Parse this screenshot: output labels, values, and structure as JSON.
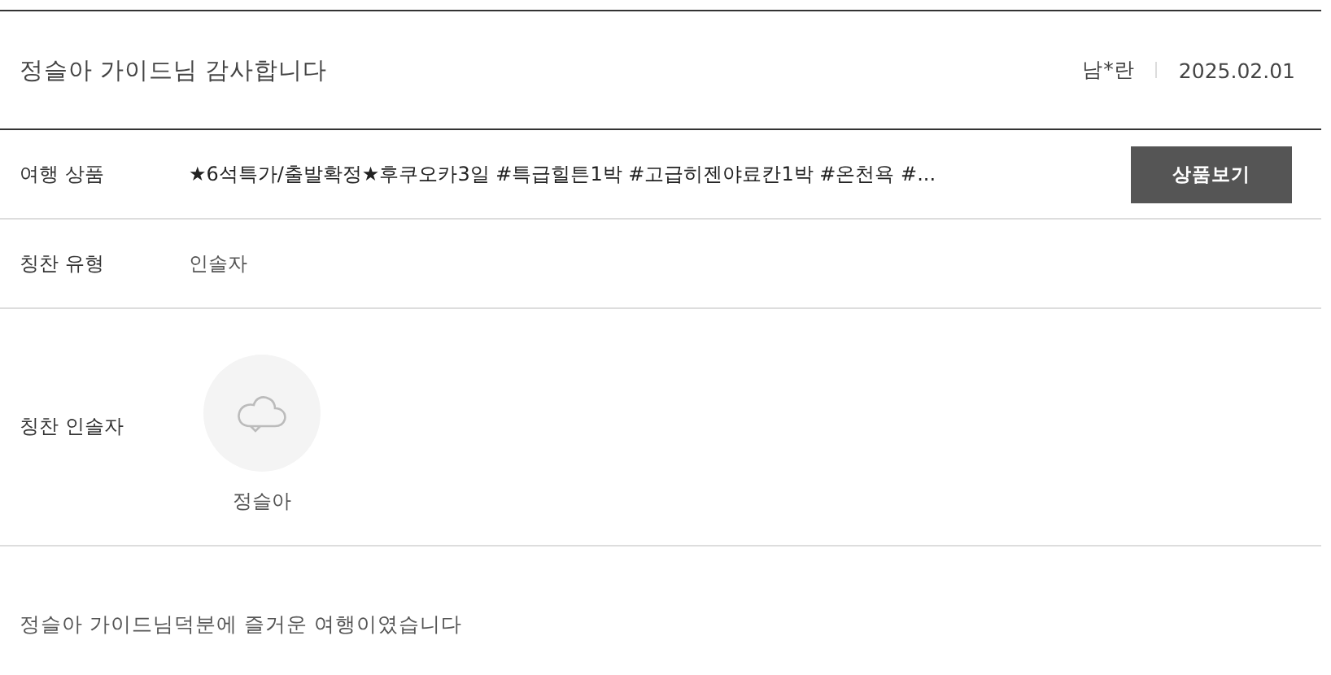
{
  "review": {
    "title": "정슬아 가이드님 감사합니다",
    "author": "남*란",
    "date": "2025.02.01"
  },
  "product": {
    "label": "여행 상품",
    "value": "★6석특가/출발확정★후쿠오카3일 #특급힐튼1박 #고급히젠야료칸1박 #온천욕 #...",
    "button": "상품보기"
  },
  "praise_type": {
    "label": "칭찬 유형",
    "value": "인솔자"
  },
  "praise_guide": {
    "label": "칭찬 인솔자",
    "name": "정슬아"
  },
  "body": "정슬아 가이드님덕분에 즐거운 여행이였습니다"
}
